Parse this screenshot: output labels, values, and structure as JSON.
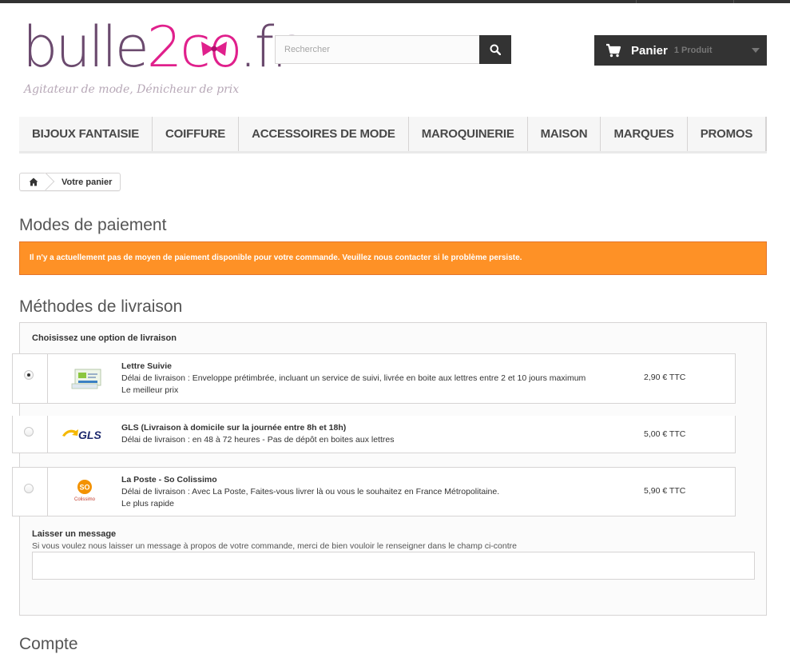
{
  "logo": {
    "main": "bulle",
    "accent": "2co",
    "suffix": ".fr",
    "tagline": "Agitateur de mode, Dénicheur de prix"
  },
  "search": {
    "placeholder": "Rechercher",
    "icon": "search-icon"
  },
  "cart": {
    "label": "Panier",
    "count": "1 Produit",
    "icon": "cart-icon"
  },
  "menu": {
    "items": [
      {
        "label": "Bijoux fantaisie"
      },
      {
        "label": "Coiffure"
      },
      {
        "label": "Accessoires de mode"
      },
      {
        "label": "Maroquinerie"
      },
      {
        "label": "Maison"
      },
      {
        "label": "Marques"
      },
      {
        "label": "Promos"
      }
    ]
  },
  "breadcrumb": {
    "home_icon": "home-icon",
    "current": "Votre panier"
  },
  "payment": {
    "title": "Modes de paiement",
    "alert": "Il n'y a actuellement pas de moyen de paiement disponible pour votre commande. Veuillez nous contacter si le problème persiste."
  },
  "delivery": {
    "title": "Méthodes de livraison",
    "subtitle": "Choisissez une option de livraison",
    "carriers": [
      {
        "name": "Lettre Suivie",
        "delay": "Délai de livraison : Enveloppe prétimbrée, incluant un service de suivi, livrée en boite aux lettres entre 2 et 10 jours maximum",
        "note": "Le meilleur prix",
        "price": "2,90 € TTC",
        "selected": true,
        "logo": "lettre-suivie-logo"
      },
      {
        "name": "GLS (Livraison à domicile sur la journée entre 8h et 18h)",
        "delay": "Délai de livraison : en 48 à 72 heures - Pas de dépôt en boites aux lettres",
        "note": "",
        "price": "5,00 € TTC",
        "selected": false,
        "logo": "gls-logo",
        "logo_text": "GLS"
      },
      {
        "name": "La Poste - So Colissimo",
        "delay": "Délai de livraison : Avec La Poste, Faites-vous livrer là ou vous le souhaitez en France Métropolitaine.",
        "note": "Le plus rapide",
        "price": "5,90 € TTC",
        "selected": false,
        "logo": "colissimo-logo",
        "logo_text": "SO",
        "logo_sub": "Colissimo"
      }
    ]
  },
  "message": {
    "title": "Laisser un message",
    "help": "Si vous voulez nous laisser un message à propos de votre commande, merci de bien vouloir le renseigner dans le champ ci-contre"
  },
  "account": {
    "title": "Compte"
  },
  "colors": {
    "accent_pink": "#e0208c",
    "logo_purple": "#6b4a6e",
    "alert_orange": "#fe9126",
    "dark": "#333333"
  }
}
